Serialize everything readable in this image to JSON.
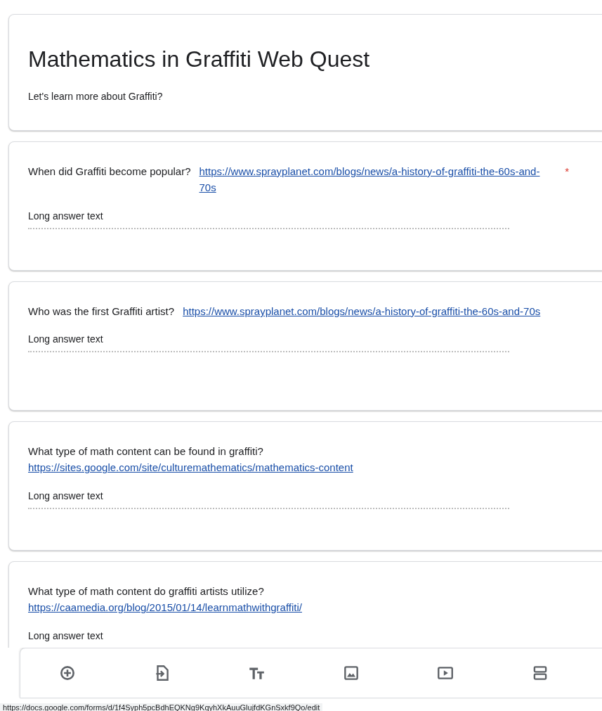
{
  "form": {
    "title": "Mathematics in Graffiti Web Quest",
    "description": "Let's learn more about Graffiti?"
  },
  "questions": [
    {
      "text": "When did Graffiti become popular?",
      "link": "https://www.sprayplanet.com/blogs/news/a-history-of-graffiti-the-60s-and-70s",
      "required_mark": "*",
      "answer_placeholder": "Long answer text"
    },
    {
      "text": "Who was the first Graffiti artist?",
      "link": "https://www.sprayplanet.com/blogs/news/a-history-of-graffiti-the-60s-and-70s",
      "answer_placeholder": "Long answer text"
    },
    {
      "text": "What type of math content can be found in graffiti?",
      "link": "https://sites.google.com/site/culturemathematics/mathematics-content",
      "answer_placeholder": "Long answer text"
    },
    {
      "text": "What type of math content do graffiti artists utilize?",
      "link": "https://caamedia.org/blog/2015/01/14/learnmathwithgraffiti/",
      "answer_placeholder": "Long answer text"
    }
  ],
  "toolbar": [
    {
      "kind": "add-question"
    },
    {
      "kind": "import"
    },
    {
      "kind": "title"
    },
    {
      "kind": "image"
    },
    {
      "kind": "video"
    },
    {
      "kind": "section"
    }
  ],
  "status_bar": {
    "url": "https://docs.google.com/forms/d/1f4Syph5pcBdhEQKNg9KqyhXkAuuGlujfdKGnSxkf9Qo/edit"
  }
}
